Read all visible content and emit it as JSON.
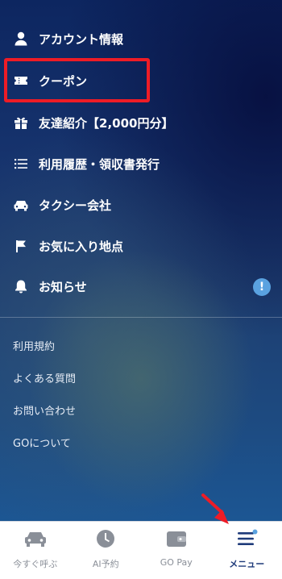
{
  "menu": {
    "items": [
      {
        "label": "アカウント情報",
        "icon": "person-icon"
      },
      {
        "label": "クーポン",
        "icon": "ticket-icon"
      },
      {
        "label": "友達紹介【2,000円分】",
        "icon": "gift-icon"
      },
      {
        "label": "利用履歴・領収書発行",
        "icon": "list-icon"
      },
      {
        "label": "タクシー会社",
        "icon": "taxi-car-icon"
      },
      {
        "label": "お気に入り地点",
        "icon": "flag-icon"
      },
      {
        "label": "お知らせ",
        "icon": "bell-icon",
        "badge": "!"
      }
    ],
    "links": [
      {
        "label": "利用規約"
      },
      {
        "label": "よくある質問"
      },
      {
        "label": "お問い合わせ"
      },
      {
        "label": "GOについて"
      }
    ]
  },
  "tabbar": {
    "tabs": [
      {
        "label": "今すぐ呼ぶ",
        "icon": "car-icon"
      },
      {
        "label": "AI予約",
        "icon": "clock-icon"
      },
      {
        "label": "GO Pay",
        "icon": "wallet-icon"
      },
      {
        "label": "メニュー",
        "icon": "menu-icon",
        "active": true
      }
    ]
  },
  "colors": {
    "highlight": "#ee1c26",
    "badge": "#5aa2e0",
    "active_tab": "#1f3b7a",
    "inactive_tab": "#8a8f98"
  }
}
